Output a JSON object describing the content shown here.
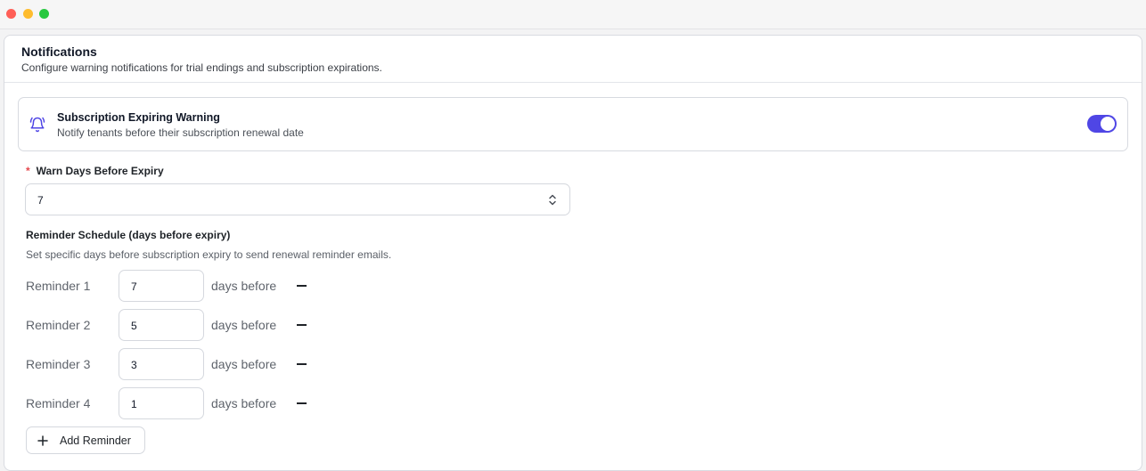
{
  "card": {
    "title": "Notifications",
    "subtitle": "Configure warning notifications for trial endings and subscription expirations."
  },
  "warning": {
    "icon": "bell-ring-icon",
    "title": "Subscription Expiring Warning",
    "description": "Notify tenants before their subscription renewal date",
    "enabled": true,
    "accent_color": "#4f46e5"
  },
  "warn_days": {
    "required_marker": "*",
    "label": "Warn Days Before Expiry",
    "value": "7"
  },
  "schedule": {
    "title": "Reminder Schedule (days before expiry)",
    "description": "Set specific days before subscription expiry to send renewal reminder emails.",
    "suffix": "days before",
    "reminders": [
      {
        "label": "Reminder 1",
        "value": "7"
      },
      {
        "label": "Reminder 2",
        "value": "5"
      },
      {
        "label": "Reminder 3",
        "value": "3"
      },
      {
        "label": "Reminder 4",
        "value": "1"
      }
    ],
    "add_label": "Add Reminder"
  }
}
